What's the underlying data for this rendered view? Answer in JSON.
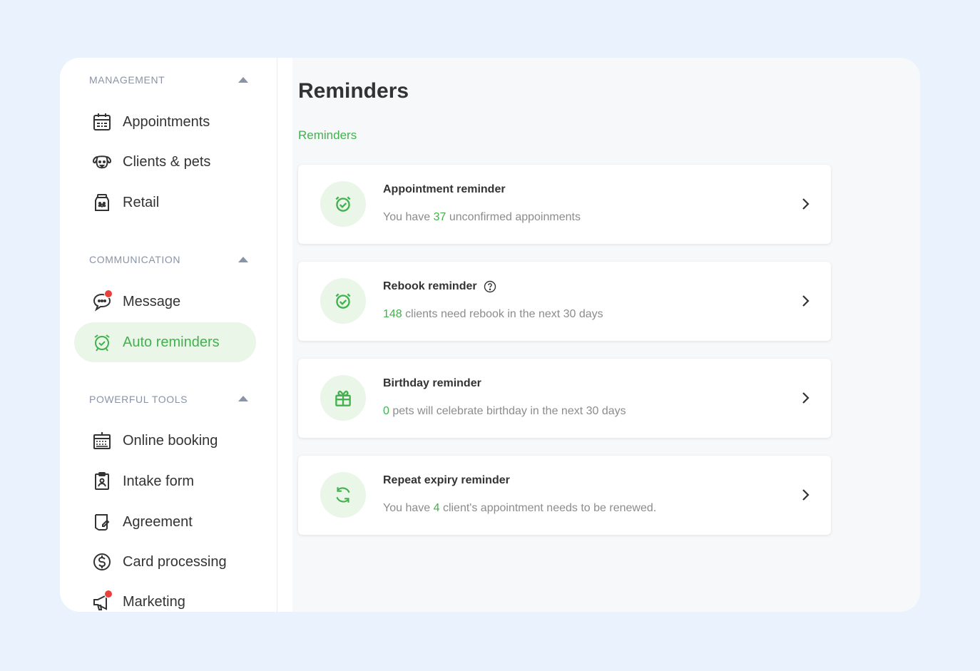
{
  "sidebar": {
    "sections": [
      {
        "heading": "MANAGEMENT",
        "items": [
          {
            "label": "Appointments",
            "icon": "calendar-icon"
          },
          {
            "label": "Clients & pets",
            "icon": "dog-icon"
          },
          {
            "label": "Retail",
            "icon": "jar-icon"
          }
        ]
      },
      {
        "heading": "COMMUNICATION",
        "items": [
          {
            "label": "Message",
            "icon": "chat-bubble-icon",
            "notification_dot": true
          },
          {
            "label": "Auto reminders",
            "icon": "alarm-clock-icon",
            "active": true
          }
        ]
      },
      {
        "heading": "POWERFUL TOOLS",
        "items": [
          {
            "label": "Online booking",
            "icon": "calendar-grid-icon"
          },
          {
            "label": "Intake form",
            "icon": "clipboard-user-icon"
          },
          {
            "label": "Agreement",
            "icon": "document-sign-icon"
          },
          {
            "label": "Card processing",
            "icon": "dollar-circle-icon"
          },
          {
            "label": "Marketing",
            "icon": "megaphone-icon",
            "notification_dot": true
          }
        ]
      }
    ]
  },
  "main": {
    "title": "Reminders",
    "breadcrumb": "Reminders",
    "cards": [
      {
        "title": "Appointment reminder",
        "icon": "alarm-clock-icon",
        "desc_pre": "You have ",
        "num": "37",
        "desc_post": " unconfirmed appoinments"
      },
      {
        "title": "Rebook reminder",
        "icon": "alarm-clock-icon",
        "help_icon": "question-circle-icon",
        "desc_pre": "",
        "num": "148",
        "desc_post": " clients need rebook in the next 30 days"
      },
      {
        "title": "Birthday reminder",
        "icon": "gift-icon",
        "desc_pre": "",
        "num": "0",
        "desc_post": " pets will celebrate birthday in the next 30 days"
      },
      {
        "title": "Repeat expiry reminder",
        "icon": "refresh-icon",
        "desc_pre": "You have ",
        "num": "4",
        "desc_post": " client's appointment needs to be renewed."
      }
    ]
  },
  "colors": {
    "accent": "#43b14e",
    "accent_bg": "#e9f6e8",
    "page_bg": "#eaf2fd",
    "badge_dot": "#e8403a",
    "muted": "#8a94a6"
  }
}
